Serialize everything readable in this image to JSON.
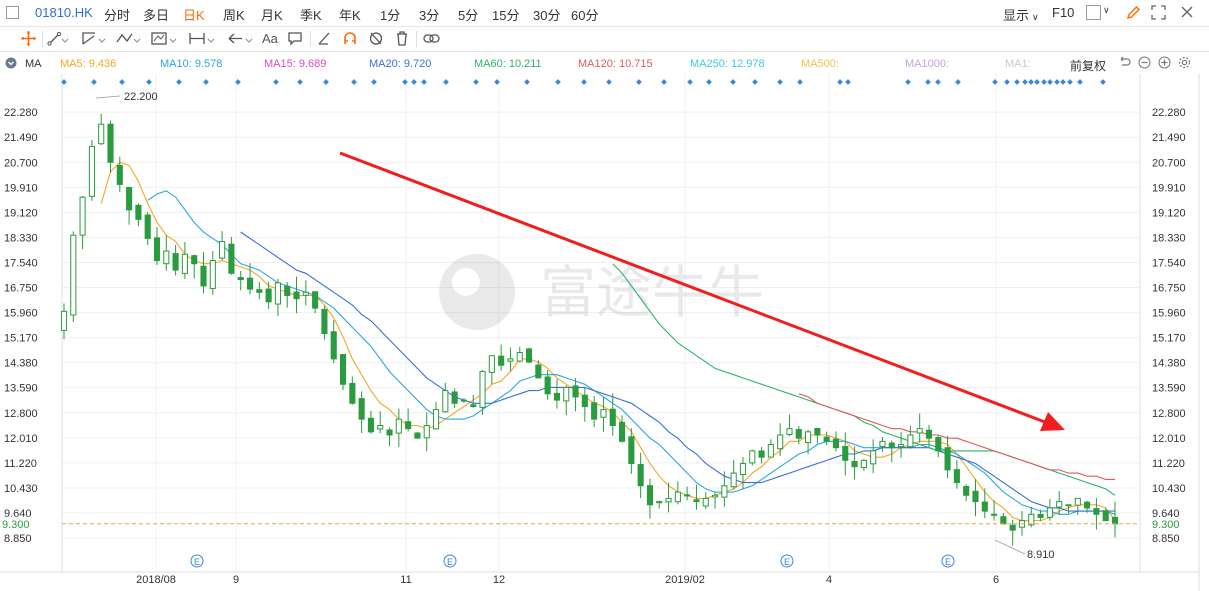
{
  "header": {
    "symbol": "01810.HK",
    "periods": [
      "分时",
      "多日",
      "日K",
      "周K",
      "月K",
      "季K",
      "年K",
      "1分",
      "3分",
      "5分",
      "15分",
      "30分",
      "60分"
    ],
    "active_period": "日K",
    "display_label": "显示",
    "f10_label": "F10"
  },
  "toolbar": {
    "text_tool_label": "Aa"
  },
  "ma_bar": {
    "prefix": "MA",
    "items": [
      {
        "label": "MA5: 9.436",
        "color": "#f5a623"
      },
      {
        "label": "MA10: 9.578",
        "color": "#2aa7e0"
      },
      {
        "label": "MA15: 9.689",
        "color": "#d94cc3"
      },
      {
        "label": "MA20: 9.720",
        "color": "#3a6fd8"
      },
      {
        "label": "MA60: 10.211",
        "color": "#2db36b"
      },
      {
        "label": "MA120: 10.715",
        "color": "#e05a5a"
      },
      {
        "label": "MA250: 12.978",
        "color": "#3fc9e0"
      },
      {
        "label": "MA500:",
        "color": "#f5c04a"
      },
      {
        "label": "MA1000:",
        "color": "#c7a0e8"
      },
      {
        "label": "MA1:",
        "color": "#c9c9c9"
      }
    ],
    "restore_label": "前复权"
  },
  "chart_data": {
    "type": "candlestick",
    "y_ticks": [
      "22.280",
      "21.490",
      "20.700",
      "19.910",
      "19.120",
      "18.330",
      "17.540",
      "16.750",
      "15.960",
      "15.170",
      "14.380",
      "13.590",
      "12.800",
      "12.010",
      "11.220",
      "10.430",
      "9.640",
      "8.850"
    ],
    "ylim": [
      8.6,
      22.6
    ],
    "x_labels": [
      "2018/08",
      "9",
      "11",
      "12",
      "2019/02",
      "4",
      "6"
    ],
    "high_label": "22.200",
    "low_label": "8.910",
    "current_price": "9.300",
    "current_price_value": 9.3,
    "watermark": "富途牛牛",
    "closes": [
      16.0,
      18.4,
      19.6,
      21.2,
      21.9,
      20.7,
      20.0,
      19.2,
      18.9,
      18.3,
      17.6,
      17.9,
      17.3,
      17.8,
      17.5,
      16.8,
      17.6,
      18.2,
      17.2,
      17.0,
      16.7,
      16.6,
      16.3,
      16.9,
      16.5,
      16.4,
      16.6,
      16.1,
      15.3,
      14.5,
      13.7,
      13.1,
      12.6,
      12.2,
      12.4,
      12.1,
      12.6,
      12.3,
      12.0,
      12.4,
      12.9,
      13.5,
      13.1,
      13.2,
      13.0,
      14.1,
      14.6,
      14.3,
      14.5,
      14.7,
      14.4,
      13.9,
      13.4,
      13.2,
      13.6,
      13.3,
      13.0,
      12.6,
      12.9,
      12.4,
      11.9,
      11.2,
      10.5,
      9.9,
      10.0,
      10.1,
      10.3,
      10.2,
      10.0,
      10.1,
      10.2,
      10.5,
      10.9,
      11.2,
      11.6,
      11.4,
      11.8,
      12.1,
      12.3,
      12.0,
      12.2,
      12.1,
      11.9,
      11.7,
      11.3,
      11.1,
      11.3,
      11.6,
      11.9,
      11.7,
      11.8,
      12.1,
      12.3,
      12.0,
      11.6,
      11.0,
      10.6,
      10.2,
      10.0,
      9.7,
      9.6,
      9.3,
      9.1,
      9.4,
      9.6,
      9.5,
      9.8,
      10.0,
      9.9,
      10.1,
      9.8,
      9.6,
      9.4,
      9.3
    ],
    "series": [
      {
        "name": "MA5",
        "color": "#f5a623",
        "values": [
          null,
          null,
          null,
          null,
          19.4,
          20.4,
          20.7,
          20.6,
          20.1,
          19.4,
          18.8,
          18.4,
          18.2,
          17.8,
          17.6,
          17.5,
          17.5,
          17.6,
          17.5,
          17.4,
          17.3,
          17.1,
          16.8,
          16.7,
          16.6,
          16.5,
          16.5,
          16.5,
          16.2,
          15.8,
          15.2,
          14.5,
          14.0,
          13.5,
          13.1,
          12.9,
          12.6,
          12.4,
          12.4,
          12.3,
          12.4,
          12.6,
          12.8,
          13.0,
          13.2,
          13.4,
          13.7,
          13.8,
          14.1,
          14.5,
          14.5,
          14.4,
          14.2,
          13.9,
          13.7,
          13.5,
          13.3,
          13.1,
          13.0,
          12.8,
          12.5,
          12.2,
          11.7,
          11.2,
          10.8,
          10.5,
          10.3,
          10.2,
          10.1,
          10.1,
          10.2,
          10.3,
          10.4,
          10.6,
          10.9,
          11.1,
          11.4,
          11.6,
          11.9,
          11.9,
          12.1,
          12.1,
          12.1,
          12.0,
          11.9,
          11.6,
          11.5,
          11.4,
          11.4,
          11.5,
          11.7,
          11.8,
          11.9,
          11.9,
          11.9,
          11.8,
          11.5,
          11.1,
          10.7,
          10.3,
          10.0,
          9.8,
          9.5,
          9.4,
          9.4,
          9.4,
          9.5,
          9.7,
          9.8,
          9.9,
          9.9,
          9.9,
          9.8,
          9.4
        ]
      },
      {
        "name": "MA10",
        "color": "#2aa7e0",
        "values": [
          null,
          null,
          null,
          null,
          null,
          null,
          null,
          null,
          null,
          19.5,
          19.7,
          19.8,
          19.6,
          19.2,
          18.8,
          18.5,
          18.3,
          18.1,
          17.8,
          17.5,
          17.4,
          17.3,
          17.1,
          16.9,
          16.8,
          16.7,
          16.6,
          16.5,
          16.3,
          16.1,
          15.8,
          15.5,
          15.2,
          14.9,
          14.5,
          14.1,
          13.8,
          13.5,
          13.2,
          12.9,
          12.7,
          12.6,
          12.6,
          12.6,
          12.7,
          12.9,
          13.1,
          13.3,
          13.5,
          13.8,
          13.9,
          14.0,
          14.0,
          14.0,
          13.9,
          13.8,
          13.7,
          13.5,
          13.3,
          13.1,
          12.9,
          12.6,
          12.3,
          12.0,
          11.8,
          11.5,
          11.2,
          10.9,
          10.6,
          10.4,
          10.3,
          10.3,
          10.3,
          10.4,
          10.5,
          10.7,
          10.9,
          11.1,
          11.3,
          11.5,
          11.6,
          11.8,
          11.9,
          11.9,
          11.9,
          11.8,
          11.7,
          11.7,
          11.7,
          11.7,
          11.7,
          11.7,
          11.8,
          11.8,
          11.7,
          11.6,
          11.5,
          11.3,
          11.1,
          10.9,
          10.6,
          10.3,
          10.1,
          9.9,
          9.8,
          9.7,
          9.7,
          9.6,
          9.6,
          9.7,
          9.7,
          9.7,
          9.7,
          9.6
        ]
      },
      {
        "name": "MA20",
        "color": "#3a6fd8",
        "values": [
          null,
          null,
          null,
          null,
          null,
          null,
          null,
          null,
          null,
          null,
          null,
          null,
          null,
          null,
          null,
          null,
          null,
          null,
          null,
          18.5,
          18.3,
          18.1,
          17.9,
          17.7,
          17.5,
          17.3,
          17.2,
          17.0,
          16.8,
          16.6,
          16.4,
          16.2,
          15.9,
          15.7,
          15.4,
          15.1,
          14.8,
          14.5,
          14.2,
          13.9,
          13.7,
          13.5,
          13.3,
          13.2,
          13.1,
          13.1,
          13.1,
          13.2,
          13.3,
          13.4,
          13.5,
          13.5,
          13.6,
          13.6,
          13.6,
          13.6,
          13.6,
          13.5,
          13.4,
          13.3,
          13.2,
          13.1,
          12.9,
          12.7,
          12.5,
          12.2,
          12.0,
          11.7,
          11.5,
          11.2,
          11.0,
          10.8,
          10.7,
          10.6,
          10.6,
          10.6,
          10.7,
          10.8,
          10.9,
          11.0,
          11.1,
          11.2,
          11.3,
          11.4,
          11.5,
          11.5,
          11.6,
          11.6,
          11.7,
          11.7,
          11.7,
          11.7,
          11.7,
          11.7,
          11.6,
          11.5,
          11.4,
          11.3,
          11.2,
          11.0,
          10.8,
          10.6,
          10.4,
          10.2,
          10.0,
          9.9,
          9.8,
          9.8,
          9.7,
          9.7,
          9.7,
          9.7,
          9.7,
          9.7
        ]
      },
      {
        "name": "MA60",
        "color": "#2db36b",
        "values": [
          null,
          null,
          null,
          null,
          null,
          null,
          null,
          null,
          null,
          null,
          null,
          null,
          null,
          null,
          null,
          null,
          null,
          null,
          null,
          null,
          null,
          null,
          null,
          null,
          null,
          null,
          null,
          null,
          null,
          null,
          null,
          null,
          null,
          null,
          null,
          null,
          null,
          null,
          null,
          null,
          null,
          null,
          null,
          null,
          null,
          null,
          null,
          null,
          null,
          null,
          null,
          null,
          null,
          null,
          null,
          null,
          null,
          null,
          null,
          17.5,
          17.2,
          16.8,
          16.4,
          16.0,
          15.6,
          15.3,
          15.0,
          14.8,
          14.6,
          14.4,
          14.2,
          14.1,
          14.0,
          13.9,
          13.8,
          13.7,
          13.6,
          13.5,
          13.4,
          13.3,
          13.2,
          13.1,
          13.0,
          12.9,
          12.8,
          12.7,
          12.5,
          12.4,
          12.2,
          12.1,
          12.0,
          11.9,
          11.8,
          11.7,
          11.6,
          11.6,
          11.6,
          11.6,
          11.6,
          11.6,
          11.6,
          11.5,
          11.4,
          11.3,
          11.2,
          11.1,
          11.0,
          10.9,
          10.8,
          10.7,
          10.6,
          10.5,
          10.4,
          10.2
        ]
      },
      {
        "name": "MA120",
        "color": "#e05a5a",
        "values": [
          null,
          null,
          null,
          null,
          null,
          null,
          null,
          null,
          null,
          null,
          null,
          null,
          null,
          null,
          null,
          null,
          null,
          null,
          null,
          null,
          null,
          null,
          null,
          null,
          null,
          null,
          null,
          null,
          null,
          null,
          null,
          null,
          null,
          null,
          null,
          null,
          null,
          null,
          null,
          null,
          null,
          null,
          null,
          null,
          null,
          null,
          null,
          null,
          null,
          null,
          null,
          null,
          null,
          null,
          null,
          null,
          null,
          null,
          null,
          null,
          null,
          null,
          null,
          null,
          null,
          null,
          null,
          null,
          null,
          null,
          null,
          null,
          null,
          null,
          null,
          null,
          null,
          null,
          null,
          13.4,
          13.3,
          13.1,
          13.0,
          12.9,
          12.8,
          12.7,
          12.6,
          12.5,
          12.4,
          12.3,
          12.3,
          12.2,
          12.2,
          12.1,
          12.1,
          12.0,
          12.0,
          11.9,
          11.8,
          11.7,
          11.6,
          11.5,
          11.4,
          11.3,
          11.2,
          11.1,
          11.0,
          11.0,
          10.9,
          10.9,
          10.8,
          10.8,
          10.7,
          10.7
        ]
      }
    ]
  }
}
